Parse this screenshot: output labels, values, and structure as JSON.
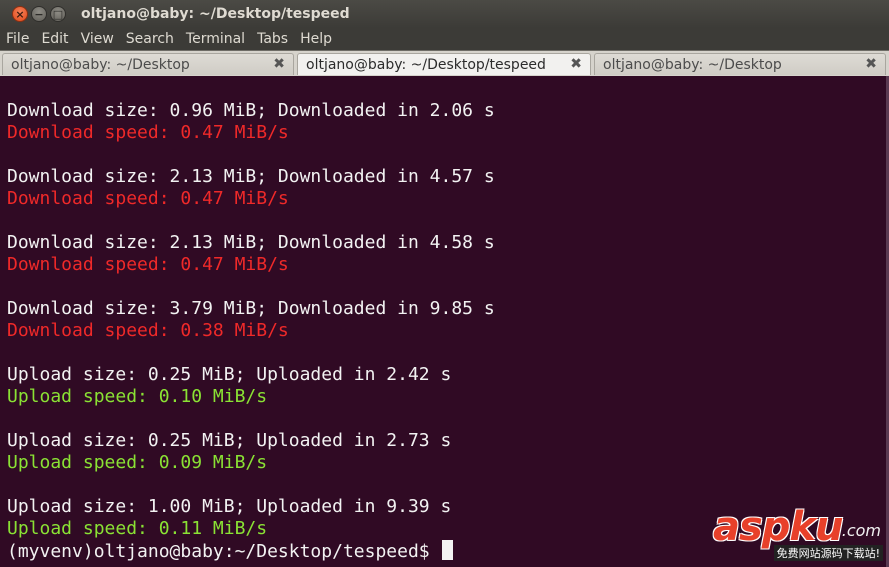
{
  "window": {
    "title": "oltjano@baby: ~/Desktop/tespeed",
    "close_glyph": "×",
    "min_glyph": "−",
    "max_glyph": "□"
  },
  "menu": [
    "File",
    "Edit",
    "View",
    "Search",
    "Terminal",
    "Tabs",
    "Help"
  ],
  "tabs": [
    {
      "label": "oltjano@baby: ~/Desktop",
      "active": false,
      "close": "✖"
    },
    {
      "label": "oltjano@baby: ~/Desktop/tespeed",
      "active": true,
      "close": "✖"
    },
    {
      "label": "oltjano@baby: ~/Desktop",
      "active": false,
      "close": "✖"
    }
  ],
  "terminal": {
    "lines": [
      {
        "text": "Download size: 0.96 MiB; Downloaded in 2.06 s",
        "color": "white"
      },
      {
        "text": "Download speed: 0.47 MiB/s",
        "color": "red"
      },
      {
        "text": "Download size: 2.13 MiB; Downloaded in 4.57 s",
        "color": "white"
      },
      {
        "text": "Download speed: 0.47 MiB/s",
        "color": "red"
      },
      {
        "text": "Download size: 2.13 MiB; Downloaded in 4.58 s",
        "color": "white"
      },
      {
        "text": "Download speed: 0.47 MiB/s",
        "color": "red"
      },
      {
        "text": "Download size: 3.79 MiB; Downloaded in 9.85 s",
        "color": "white"
      },
      {
        "text": "Download speed: 0.38 MiB/s",
        "color": "red"
      },
      {
        "text": "Upload size: 0.25 MiB; Uploaded in 2.42 s",
        "color": "white"
      },
      {
        "text": "Upload speed: 0.10 MiB/s",
        "color": "green"
      },
      {
        "text": "Upload size: 0.25 MiB; Uploaded in 2.73 s",
        "color": "white"
      },
      {
        "text": "Upload speed: 0.09 MiB/s",
        "color": "green"
      },
      {
        "text": "Upload size: 1.00 MiB; Uploaded in 9.39 s",
        "color": "white"
      },
      {
        "text": "Upload speed: 0.11 MiB/s",
        "color": "green"
      }
    ],
    "prompt": "(myvenv)oltjano@baby:~/Desktop/tespeed$",
    "colors": {
      "background": "#300a24",
      "white": "#f2f2f2",
      "red": "#ef2929",
      "green": "#8ae234"
    }
  },
  "watermark": {
    "main": "aspku",
    "domain": ".com",
    "sub": "免费网站源码下载站!"
  }
}
